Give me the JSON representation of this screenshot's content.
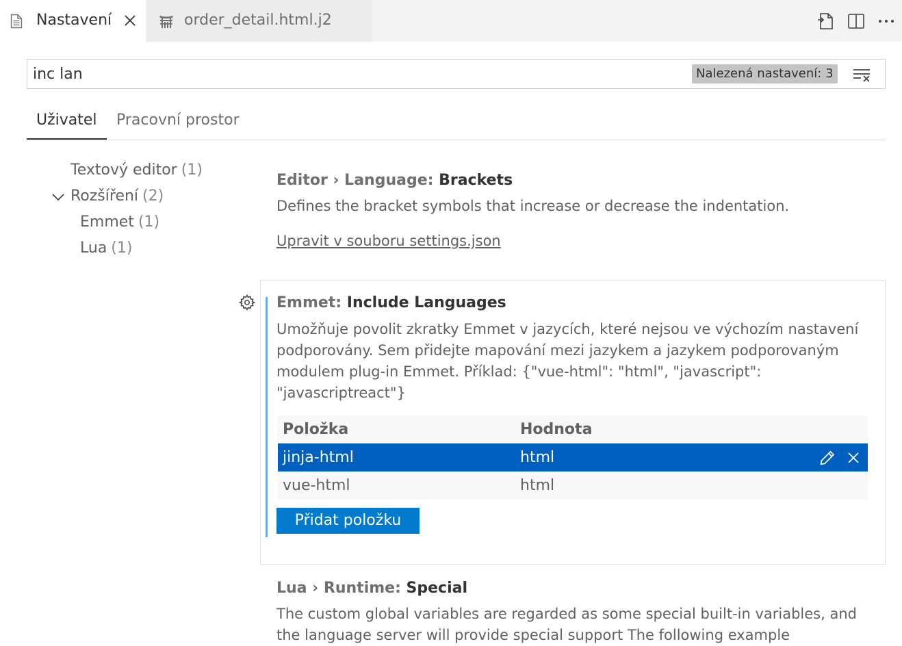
{
  "tabs": [
    {
      "label": "Nastavení",
      "icon": "settings-file-icon"
    },
    {
      "label": "order_detail.html.j2",
      "icon": "jinja-template-icon"
    }
  ],
  "search": {
    "value": "inc lan",
    "found_label": "Nalezená nastavení: 3"
  },
  "scope_tabs": [
    {
      "label": "Uživatel"
    },
    {
      "label": "Pracovní prostor"
    }
  ],
  "toc": [
    {
      "label": "Textový editor",
      "count": "(1)"
    },
    {
      "label": "Rozšíření",
      "count": "(2)"
    },
    {
      "label": "Emmet",
      "count": "(1)"
    },
    {
      "label": "Lua",
      "count": "(1)"
    }
  ],
  "settings": [
    {
      "category": "Editor › Language: ",
      "key": "Brackets",
      "description": "Defines the bracket symbols that increase or decrease the indentation.",
      "link": "Upravit v souboru settings.json"
    },
    {
      "category": "Emmet: ",
      "key": "Include Languages",
      "description": "Umožňuje povolit zkratky Emmet v jazycích, které nejsou ve výchozím nastavení podporovány. Sem přidejte mapování mezi jazykem a jazykem podporovaným modulem plug-in Emmet. Příklad: {\"vue-html\": \"html\", \"javascript\": \"javascriptreact\"}",
      "table": {
        "headers": [
          "Položka",
          "Hodnota"
        ],
        "rows": [
          {
            "item": "jinja-html",
            "value": "html"
          },
          {
            "item": "vue-html",
            "value": "html"
          }
        ]
      },
      "add_button": "Přidat položku"
    },
    {
      "category": "Lua › Runtime: ",
      "key": "Special",
      "description": "The custom global variables are regarded as some special built-in variables, and the language server will provide special support The following example"
    }
  ],
  "colors": {
    "accent": "#007acc",
    "selected_row": "#0060c0",
    "modified_bar": "#66afe0"
  }
}
